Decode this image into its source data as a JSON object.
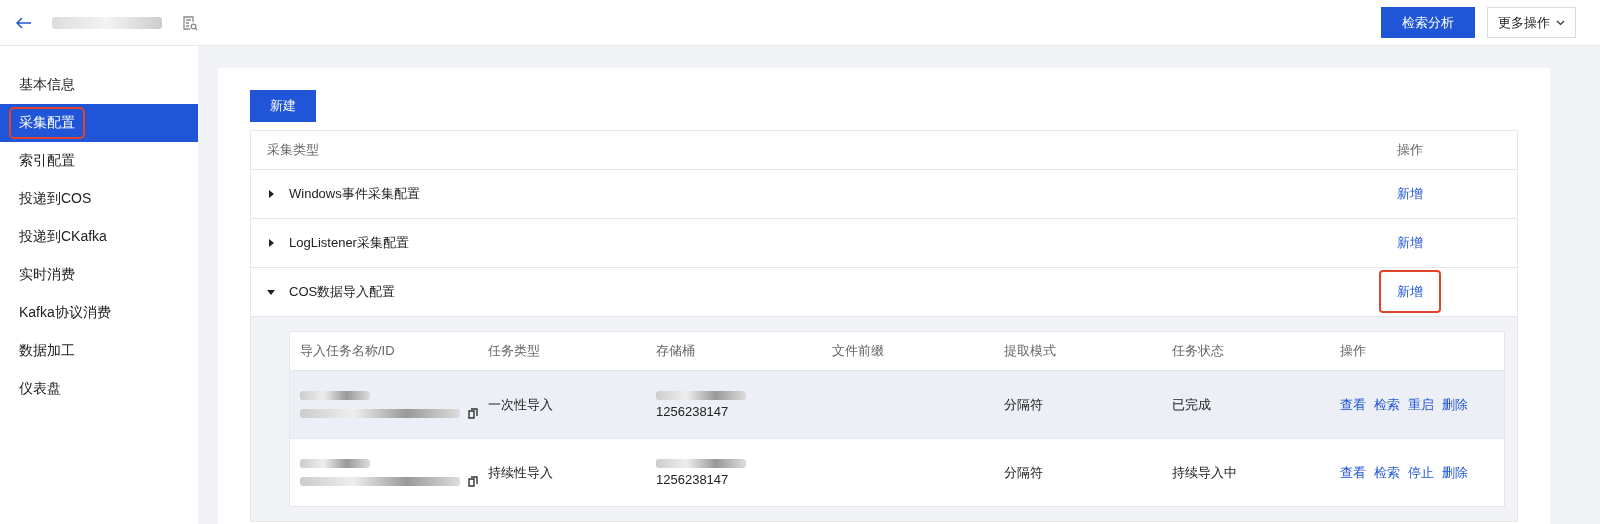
{
  "header": {
    "primary_button": "检索分析",
    "more_button": "更多操作"
  },
  "sidebar": {
    "items": [
      {
        "label": "基本信息",
        "selected": false,
        "highlighted": false
      },
      {
        "label": "采集配置",
        "selected": true,
        "highlighted": true
      },
      {
        "label": "索引配置",
        "selected": false,
        "highlighted": false
      },
      {
        "label": "投递到COS",
        "selected": false,
        "highlighted": false
      },
      {
        "label": "投递到CKafka",
        "selected": false,
        "highlighted": false
      },
      {
        "label": "实时消费",
        "selected": false,
        "highlighted": false
      },
      {
        "label": "Kafka协议消费",
        "selected": false,
        "highlighted": false
      },
      {
        "label": "数据加工",
        "selected": false,
        "highlighted": false
      },
      {
        "label": "仪表盘",
        "selected": false,
        "highlighted": false
      }
    ]
  },
  "create_button": "新建",
  "collect_table": {
    "columns": [
      "采集类型",
      "操作"
    ],
    "rows": [
      {
        "label": "Windows事件采集配置",
        "expanded": false,
        "action": "新增",
        "highlighted": false
      },
      {
        "label": "LogListener采集配置",
        "expanded": false,
        "action": "新增",
        "highlighted": false
      },
      {
        "label": "COS数据导入配置",
        "expanded": true,
        "action": "新增",
        "highlighted": true
      }
    ]
  },
  "import_tasks": {
    "columns": [
      "导入任务名称/ID",
      "任务类型",
      "存储桶",
      "文件前缀",
      "提取模式",
      "任务状态",
      "操作"
    ],
    "rows": [
      {
        "hovered": true,
        "task_type": "一次性导入",
        "bucket": "1256238147",
        "mode": "分隔符",
        "status": "已完成",
        "actions": [
          "查看",
          "检索",
          "重启",
          "删除"
        ]
      },
      {
        "hovered": false,
        "task_type": "持续性导入",
        "bucket": "1256238147",
        "mode": "分隔符",
        "status": "持续导入中",
        "actions": [
          "查看",
          "检索",
          "停止",
          "删除"
        ]
      }
    ]
  }
}
